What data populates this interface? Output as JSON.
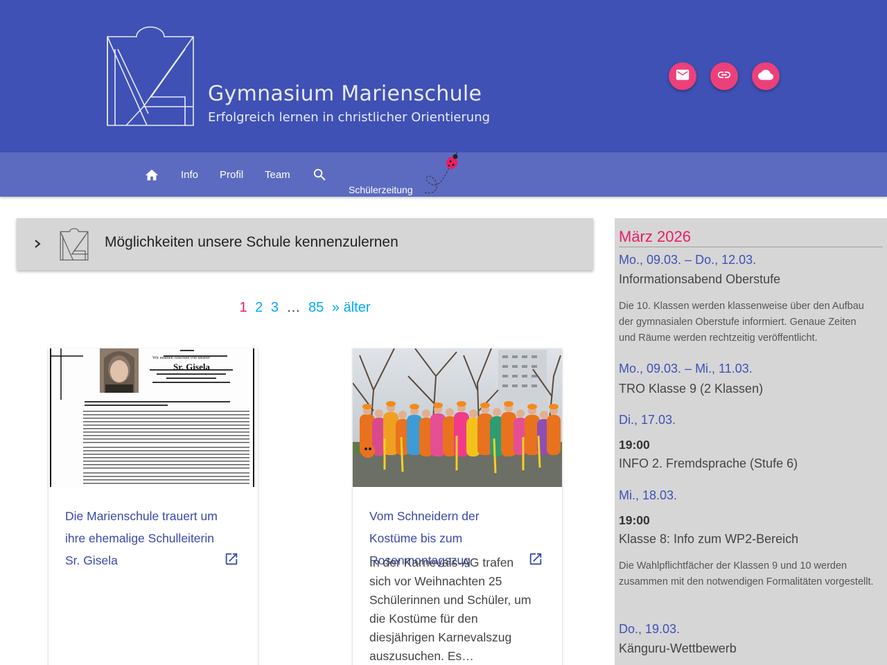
{
  "header": {
    "school_name": "Gymnasium Marienschule",
    "tagline": "Erfolgreich lernen in christlicher Orientierung",
    "buttons": [
      {
        "icon": "mail-icon"
      },
      {
        "icon": "link-icon"
      },
      {
        "icon": "cloud-icon"
      }
    ],
    "accent_color": "#ec407a",
    "brand_color": "#3f51b5"
  },
  "nav": {
    "home_icon": "home-icon",
    "items": [
      "Info",
      "Profil",
      "Team"
    ],
    "search_icon": "search-icon",
    "newspaper": "Schülerzeitung"
  },
  "accordion": {
    "title": "Möglichkeiten unsere Schule kennenzulernen"
  },
  "pagination": {
    "current": "1",
    "pages": [
      "2",
      "3"
    ],
    "ellipsis": "…",
    "last": "85",
    "older": "» älter"
  },
  "posts": [
    {
      "title": "Die Marienschule trauert um ihre ehemalige Schulleiterin Sr. Gisela",
      "excerpt": "",
      "image": {
        "heading": "Wir nehmen Abschied von unserer",
        "name": "Sr. Gisela"
      }
    },
    {
      "title": "Vom Schneidern der Kostüme bis zum Rosenmontagszug",
      "excerpt": "In der Karnevals-AG trafen sich vor Weihnachten 25 Schülerinnen und Schüler, um die Kostüme für den diesjährigen Karnevalszug auszusuchen. Es…"
    }
  ],
  "sidebar": {
    "month": "März 2026",
    "events": [
      {
        "date": "Mo., 09.03. – Do., 12.03.",
        "time": "",
        "title": "Informationsabend Oberstufe",
        "desc": "Die 10. Klassen werden klassenweise über den Aufbau der gymnasialen Oberstufe informiert. Genaue Zeiten und Räume werden rechtzeitig veröffentlicht."
      },
      {
        "date": "Mo., 09.03. – Mi., 11.03.",
        "time": "",
        "title": "TRO Klasse 9 (2 Klassen)",
        "desc": ""
      },
      {
        "date": "Di., 17.03.",
        "time": "19:00",
        "title": "INFO 2. Fremdsprache (Stufe 6)",
        "desc": ""
      },
      {
        "date": "Mi., 18.03.",
        "time": "19:00",
        "title": "Klasse 8: Info zum WP2-Bereich",
        "desc": "Die Wahlpflichtfächer der Klassen 9 und 10 werden zusammen mit den notwendigen Formalitäten vorgestellt."
      },
      {
        "date": "Do., 19.03.",
        "time": "",
        "title": "Känguru-Wettbewerb",
        "desc": ""
      }
    ]
  }
}
